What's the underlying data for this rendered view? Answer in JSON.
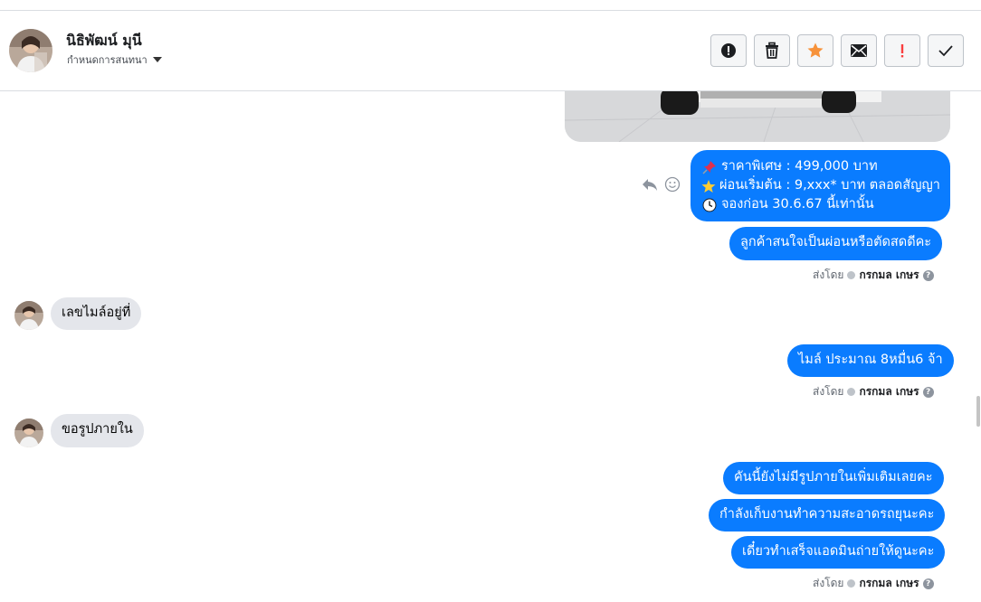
{
  "header": {
    "name": "นิธิพัฒน์ มุนี",
    "assign_label": "กำหนดการสนทนา"
  },
  "actions": [
    {
      "name": "spam-icon"
    },
    {
      "name": "trash-icon"
    },
    {
      "name": "star-icon",
      "color": "#f7923a"
    },
    {
      "name": "envelope-icon"
    },
    {
      "name": "exclamation-icon",
      "color": "#fa3e3e"
    },
    {
      "name": "check-icon"
    }
  ],
  "messages": {
    "promo": {
      "line1": "ราคาพิเศษ : 499,000 บาท",
      "line2": "ผ่อนเริ่มต้น : 9,xxx* บาท ตลอดสัญญา",
      "line3": "จองก่อน 30.6.67 นี้เท่านั้น",
      "icon1": "pushpin-emoji",
      "icon2": "star-emoji",
      "icon3": "clock-emoji"
    },
    "out_question": "ลูกค้าสนใจเป็นผ่อนหรือตัดสดดีคะ",
    "in_mileage": "เลขไมล์อยู่ที่",
    "out_mileage": "ไมล์ ประมาณ 8หมื่น6 จ้า",
    "in_photo_request": "ขอรูปภายใน",
    "out_no_photo": "คันนี้ยังไม่มีรูปภายในเพิ่มเติมเลยคะ",
    "out_cleaning": "กำลังเก็บงานทำความสะอาดรถยุนะคะ",
    "out_later": "เดี๋ยวทำเสร็จแอดมินถ่ายให้ดูนะคะ"
  },
  "sent_by": {
    "label": "ส่งโดย",
    "sender": "กรกมล เกษร"
  },
  "colors": {
    "outgoing_bubble": "#0a7cff",
    "incoming_bubble": "#e4e6eb"
  }
}
